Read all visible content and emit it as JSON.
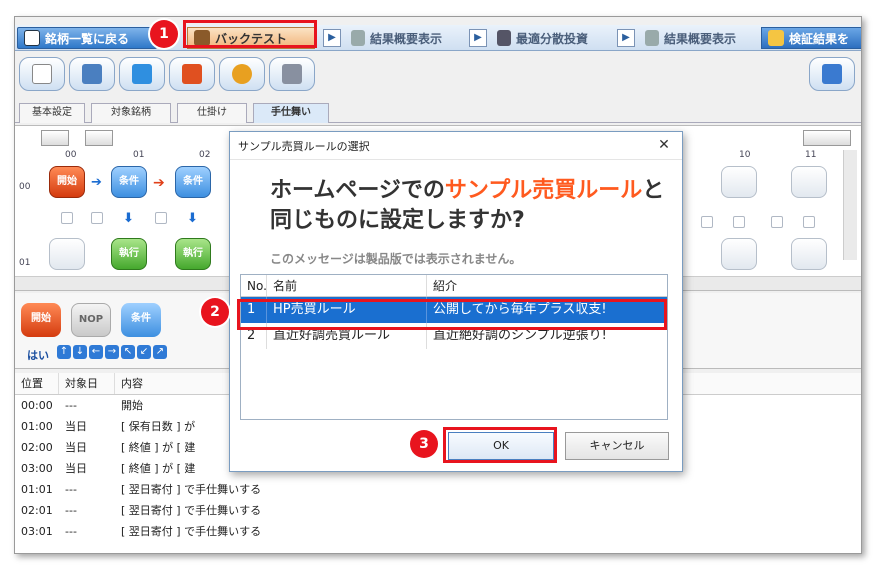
{
  "top_tabs": {
    "back": "銘柄一覧に戻る",
    "backtest": "バックテスト",
    "summary1": "結果概要表示",
    "optimize": "最適分散投資",
    "summary2": "結果概要表示",
    "verify": "検証結果を"
  },
  "sub_tabs": [
    "基本設定",
    "対象銘柄",
    "仕掛け",
    "手仕舞い"
  ],
  "grid": {
    "col_headers": [
      "00",
      "01",
      "02",
      "10",
      "11"
    ],
    "row_headers": [
      "00",
      "01"
    ],
    "start_label": "開始",
    "cond_label": "条件",
    "exec_label": "執行"
  },
  "palette": {
    "start": "開始",
    "nop": "NOP",
    "cond": "条件",
    "yes": "はい"
  },
  "log": {
    "headers": [
      "位置",
      "対象日",
      "内容"
    ],
    "rows": [
      {
        "pos": "00:00",
        "day": "---",
        "content": "開始"
      },
      {
        "pos": "01:00",
        "day": "当日",
        "content": "[ 保有日数 ] が"
      },
      {
        "pos": "02:00",
        "day": "当日",
        "content": "[ 終値 ] が [ 建"
      },
      {
        "pos": "03:00",
        "day": "当日",
        "content": "[ 終値 ] が [ 建"
      },
      {
        "pos": "01:01",
        "day": "---",
        "content": "[ 翌日寄付 ] で手仕舞いする"
      },
      {
        "pos": "02:01",
        "day": "---",
        "content": "[ 翌日寄付 ] で手仕舞いする"
      },
      {
        "pos": "03:01",
        "day": "---",
        "content": "[ 翌日寄付 ] で手仕舞いする"
      }
    ]
  },
  "dialog": {
    "title": "サンプル売買ルールの選択",
    "headline_pre": "ホームページでの",
    "headline_accent": "サンプル売買ルール",
    "headline_post": "と",
    "headline_line2": "同じものに設定しますか?",
    "note": "このメッセージは製品版では表示されません。",
    "list_headers": {
      "no": "No.",
      "name": "名前",
      "desc": "紹介"
    },
    "rows": [
      {
        "no": "1",
        "name": "HP売買ルール",
        "desc": "公開してから毎年プラス収支!"
      },
      {
        "no": "2",
        "name": "直近好調売買ルール",
        "desc": "直近絶好調のシンプル逆張り!"
      }
    ],
    "ok": "OK",
    "cancel": "キャンセル"
  },
  "callouts": [
    "1",
    "2",
    "3"
  ],
  "colors": {
    "accent": "#ff5a1f",
    "callout": "#e8141e",
    "selection": "#1a6fd0"
  }
}
